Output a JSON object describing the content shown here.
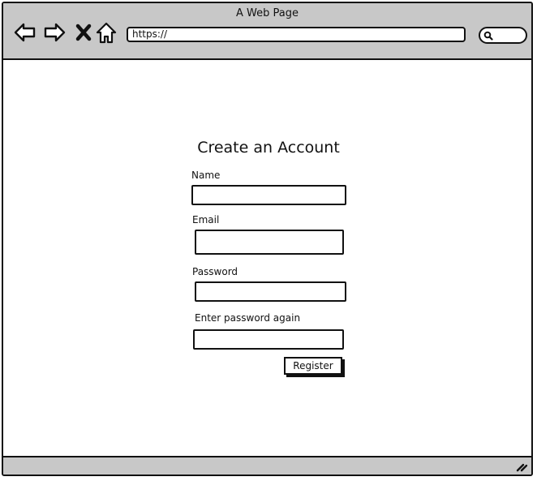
{
  "window": {
    "title": "A Web Page"
  },
  "toolbar": {
    "icons": [
      "back-arrow-icon",
      "forward-arrow-icon",
      "close-x-icon",
      "home-icon"
    ],
    "url": "https://",
    "search_icon": "search-icon"
  },
  "form": {
    "title": "Create an Account",
    "fields": [
      {
        "label": "Name",
        "value": ""
      },
      {
        "label": "Email",
        "value": ""
      },
      {
        "label": "Password",
        "value": ""
      },
      {
        "label": "Enter password again",
        "value": ""
      }
    ],
    "submit_label": "Register"
  },
  "statusbar": {
    "grip_icon": "resize-grip-icon"
  },
  "colors": {
    "chrome": "#c8c8c8",
    "ink": "#111111",
    "page": "#ffffff"
  }
}
